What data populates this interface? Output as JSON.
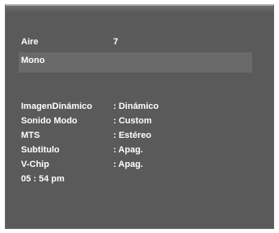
{
  "channel": {
    "source_label": "Aire",
    "number": "7",
    "audio_mode": "Mono"
  },
  "settings": [
    {
      "label": "ImagenDinámico",
      "value": ": Dinámico"
    },
    {
      "label": "Sonido Modo",
      "value": ": Custom"
    },
    {
      "label": "MTS",
      "value": ": Estéreo"
    },
    {
      "label": "Subtitulo",
      "value": ": Apag."
    },
    {
      "label": "V-Chip",
      "value": ": Apag."
    }
  ],
  "clock": {
    "time": "05 : 54 pm"
  }
}
